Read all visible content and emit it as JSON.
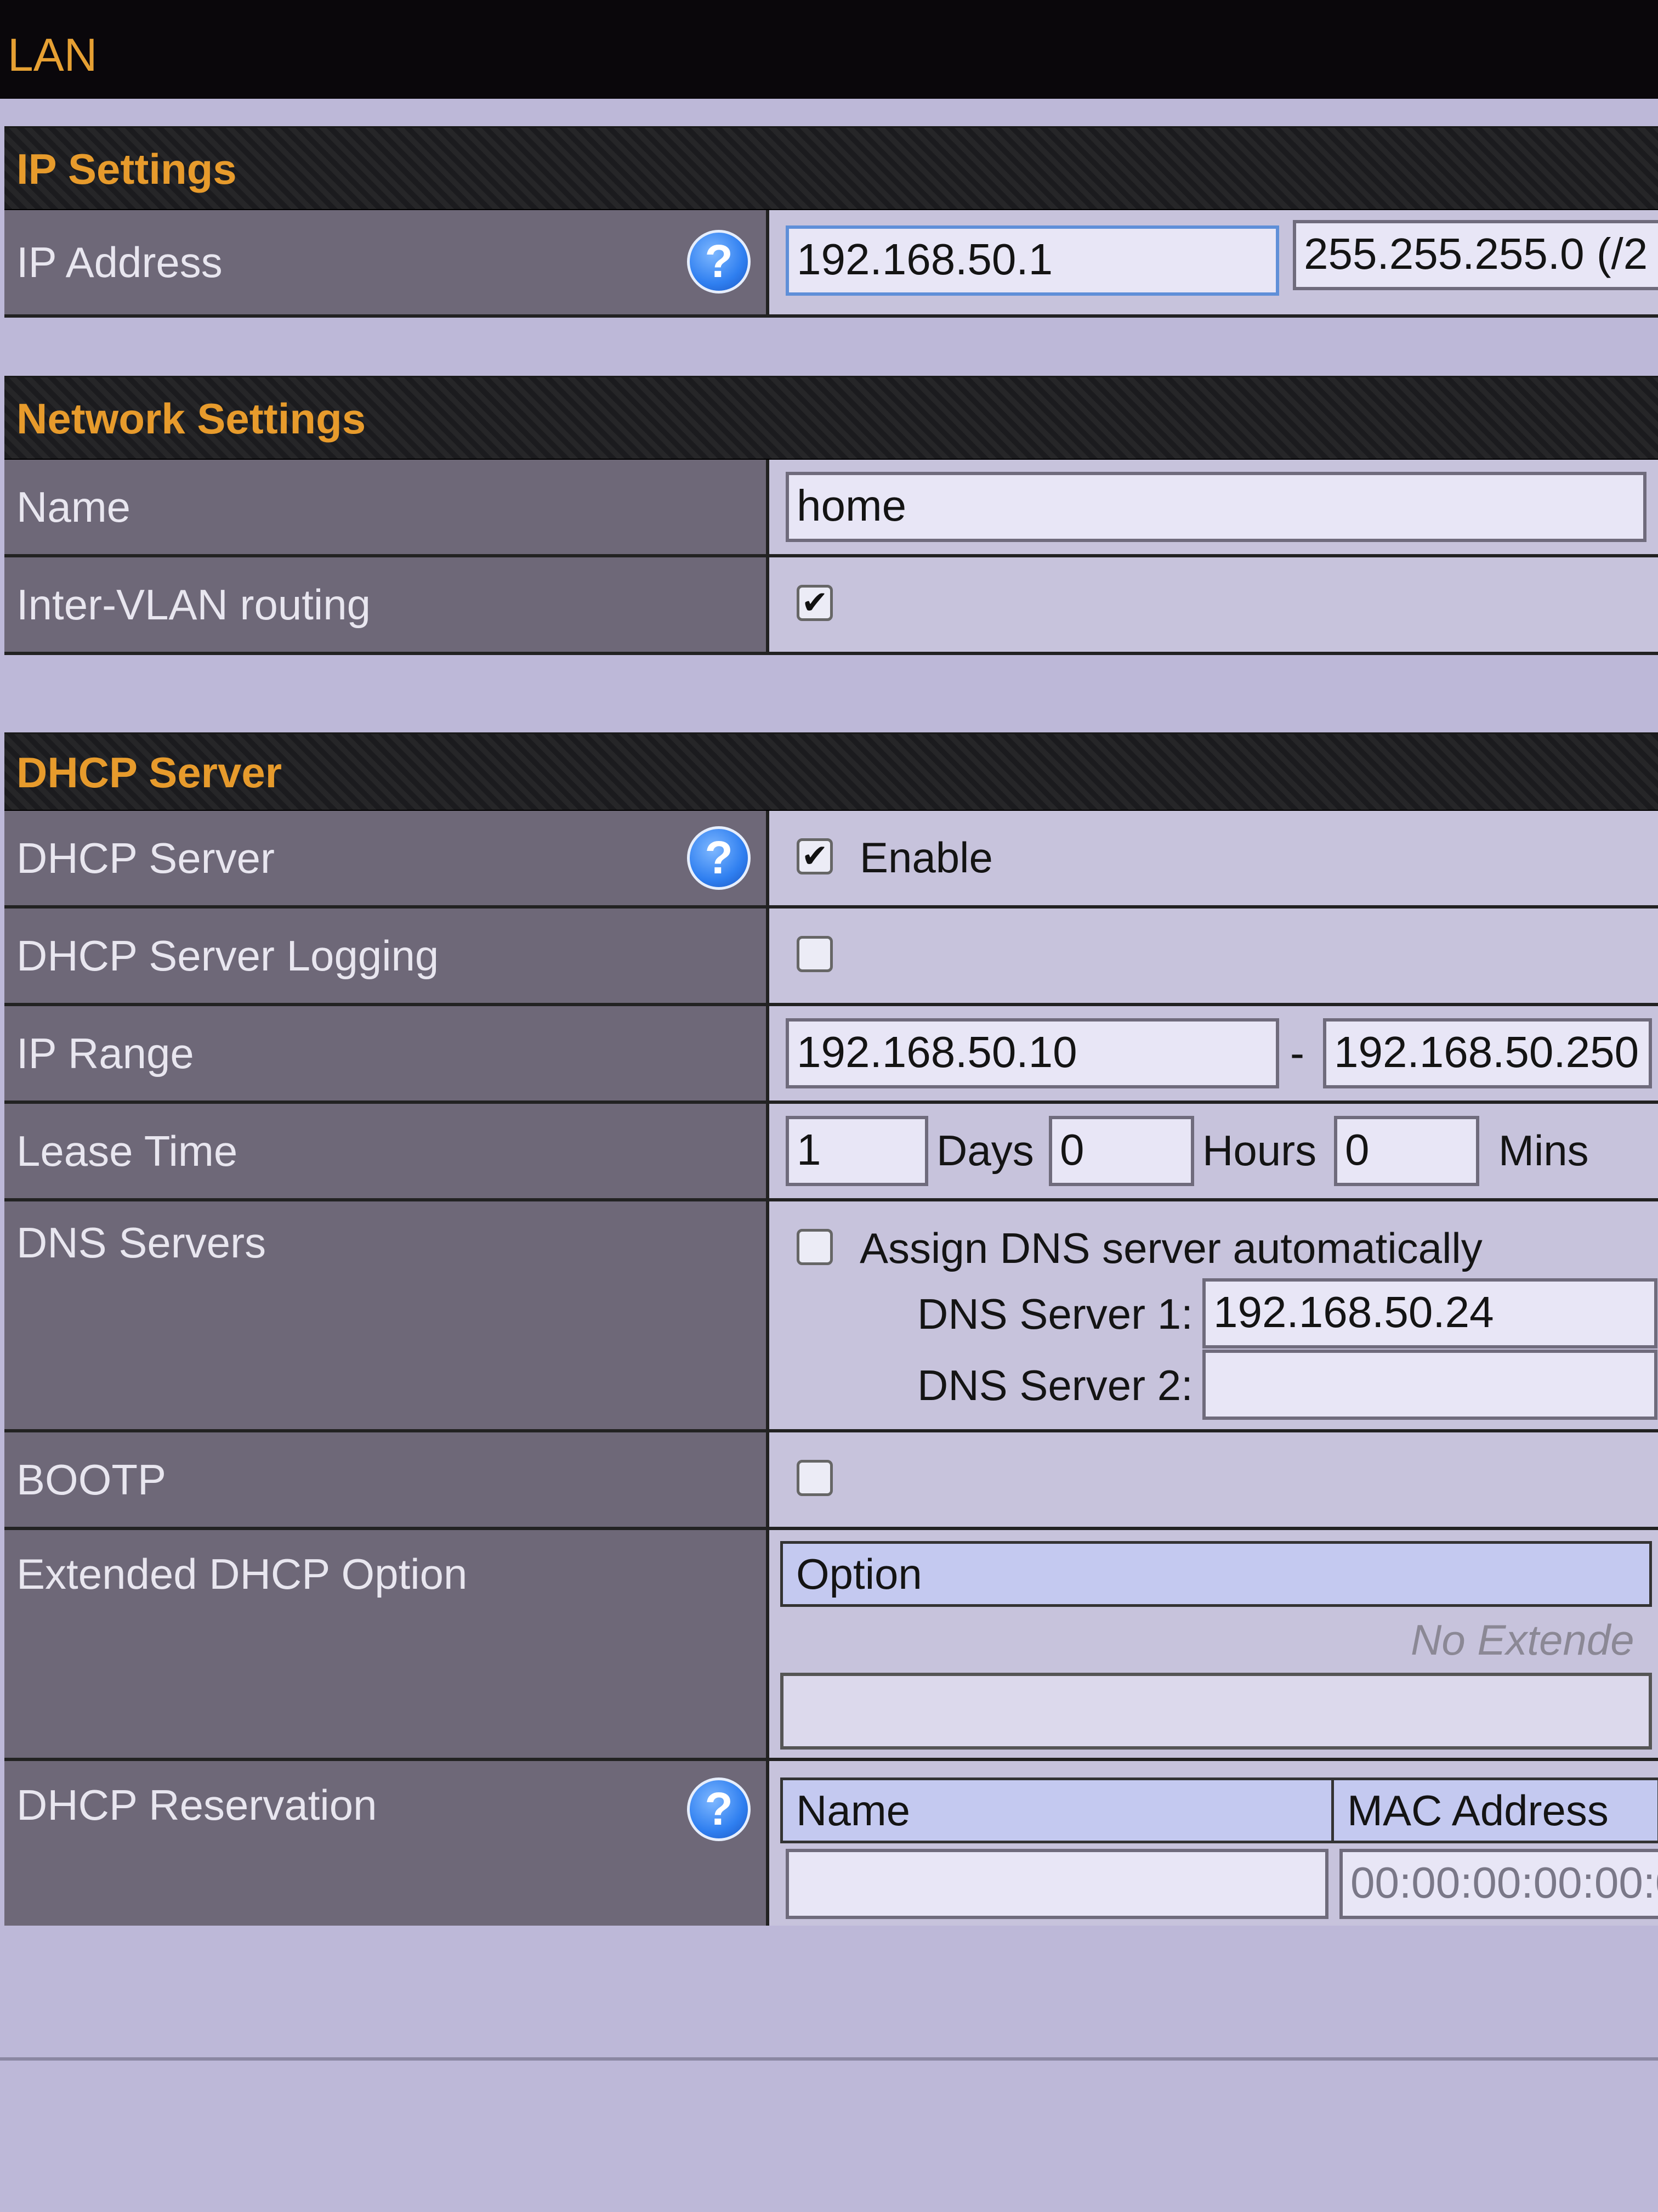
{
  "page": {
    "title": "LAN"
  },
  "ip_settings": {
    "title": "IP Settings",
    "ip_address": {
      "label": "IP Address",
      "value": "192.168.50.1",
      "subnet": "255.255.255.0 (/2"
    }
  },
  "network_settings": {
    "title": "Network Settings",
    "name": {
      "label": "Name",
      "value": "home"
    },
    "inter_vlan": {
      "label": "Inter-VLAN routing",
      "checked": true
    }
  },
  "dhcp": {
    "title": "DHCP Server",
    "server": {
      "label": "DHCP Server",
      "checked": true,
      "enable_label": "Enable"
    },
    "logging": {
      "label": "DHCP Server Logging",
      "checked": false
    },
    "ip_range": {
      "label": "IP Range",
      "start": "192.168.50.10",
      "separator": "-",
      "end": "192.168.50.250"
    },
    "lease_time": {
      "label": "Lease Time",
      "days": "1",
      "days_label": "Days",
      "hours": "0",
      "hours_label": "Hours",
      "mins": "0",
      "mins_label": "Mins"
    },
    "dns": {
      "label": "DNS Servers",
      "auto_checked": false,
      "auto_label": "Assign DNS server automatically",
      "server1_label": "DNS Server 1:",
      "server1_value": "192.168.50.24",
      "server2_label": "DNS Server 2:",
      "server2_value": ""
    },
    "bootp": {
      "label": "BOOTP",
      "checked": false
    },
    "extended": {
      "label": "Extended DHCP Option",
      "col_option": "Option",
      "empty_text": "No Extende"
    },
    "reservation": {
      "label": "DHCP Reservation",
      "col_name": "Name",
      "col_mac": "MAC Address",
      "mac_placeholder": "00:00:00:00:00:0"
    }
  },
  "icons": {
    "help": "help-circle-icon",
    "check": "checkmark-icon"
  },
  "colors": {
    "accent": "#e79b2c",
    "label_bg": "#6e6878",
    "value_bg": "#c7c3dc",
    "header_bg": "#1b1b1e",
    "help_blue": "#2f7ff0"
  }
}
